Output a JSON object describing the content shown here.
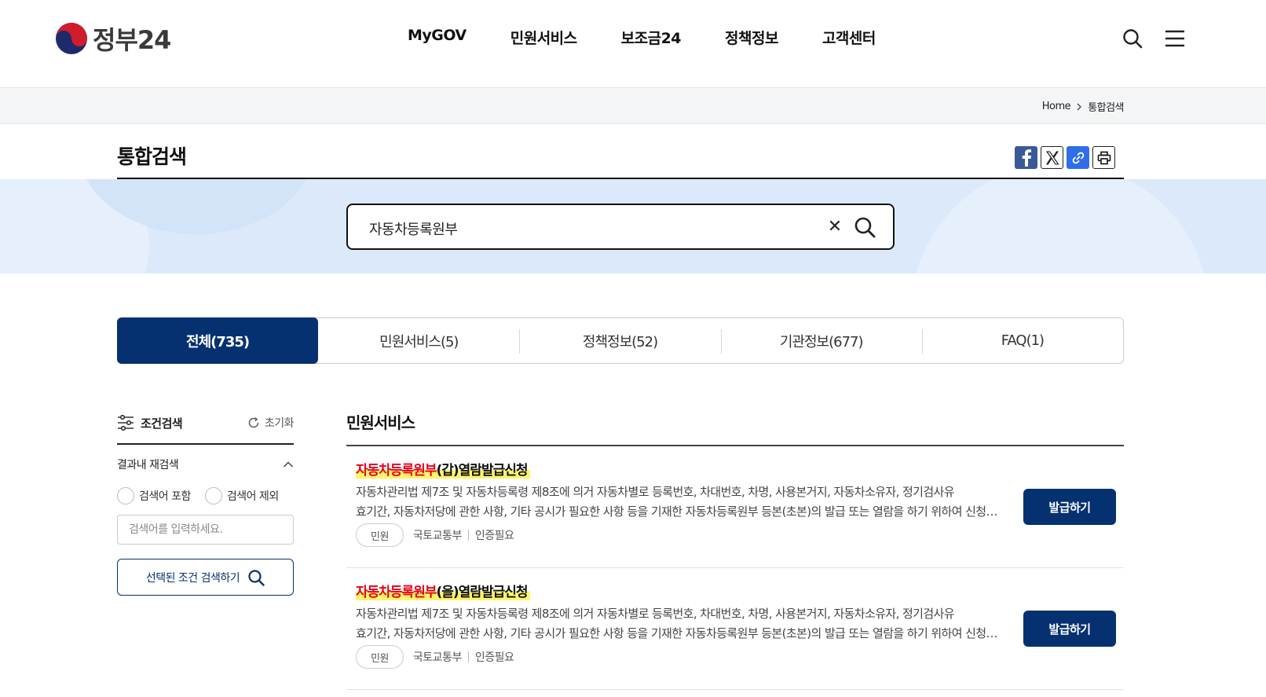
{
  "header": {
    "logo_text": "정부24",
    "nav": [
      "MyGOV",
      "민원서비스",
      "보조금24",
      "정책정보",
      "고객센터"
    ],
    "icons": [
      "search-icon",
      "menu-icon"
    ]
  },
  "breadcrumb": {
    "home": "Home",
    "current": "통합검색"
  },
  "page": {
    "title": "통합검색"
  },
  "share": [
    "facebook-icon",
    "x-icon",
    "link-icon",
    "print-icon"
  ],
  "search": {
    "value": "자동차등록원부"
  },
  "tabs": [
    {
      "label": "전체(735)",
      "active": true
    },
    {
      "label": "민원서비스(5)",
      "active": false
    },
    {
      "label": "정책정보(52)",
      "active": false
    },
    {
      "label": "기관정보(677)",
      "active": false
    },
    {
      "label": "FAQ(1)",
      "active": false
    }
  ],
  "filter": {
    "title": "조건검색",
    "reset": "초기화",
    "refine_title": "결과내 재검색",
    "include_label": "검색어 포함",
    "exclude_label": "검색어 제외",
    "placeholder": "검색어를 입력하세요.",
    "button": "선택된 조건 검색하기"
  },
  "results": {
    "section_title": "민원서비스",
    "items": [
      {
        "highlight": "자동차등록원부",
        "title_rest": "(갑)열람발급신청",
        "desc_line1": "자동차관리법 제7조 및 자동차등록령 제8조에 의거 자동차별로 등록번호, 차대번호, 차명, 사용본거지, 자동차소유자, 정기검사유",
        "desc_line2": "효기간, 자동차저당에 관한 사항, 기타 공시가 필요한 사항 등을 기재한 자동차등록원부 등본(초본)의 발급 또는 열람을 하기 위하여 신청하는 민원입니다.",
        "badge": "민원",
        "agency": "국토교통부",
        "auth": "인증필요",
        "button": "발급하기"
      },
      {
        "highlight": "자동차등록원부",
        "title_rest": "(을)열람발급신청",
        "desc_line1": "자동차관리법 제7조 및 자동차등록령 제8조에 의거 자동차별로 등록번호, 차대번호, 차명, 사용본거지, 자동차소유자, 정기검사유",
        "desc_line2": "효기간, 자동차저당에 관한 사항, 기타 공시가 필요한 사항 등을 기재한 자동차등록원부 등본(초본)의 발급 또는 열람을 하기 위하여 신청하는 민원입니다.",
        "badge": "민원",
        "agency": "국토교통부",
        "auth": "인증필요",
        "button": "발급하기"
      }
    ]
  },
  "colors": {
    "primary": "#063171",
    "highlight_text": "#e8001c",
    "highlight_bg": "#fff46b",
    "band": "#dbe9fa"
  }
}
